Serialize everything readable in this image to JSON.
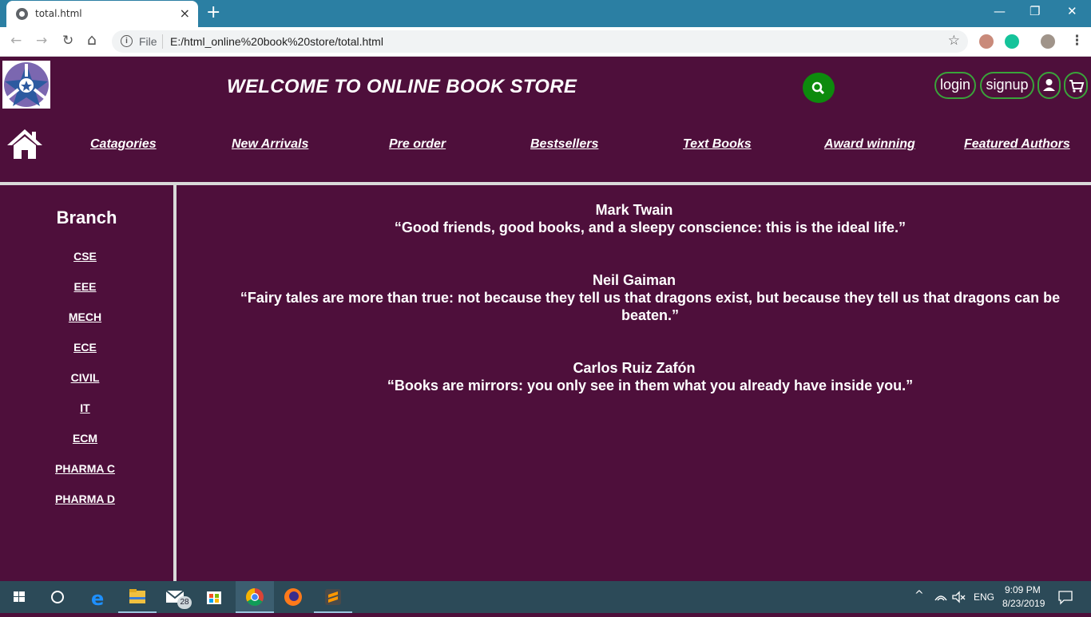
{
  "browser": {
    "tab_title": "total.html",
    "tab_close": "×",
    "new_tab": "+",
    "window_controls": {
      "minimize": "—",
      "restore": "❐",
      "close": "✕"
    },
    "nav": {
      "back": "←",
      "forward": "→",
      "reload": "↻",
      "home": "⌂"
    },
    "omnibox": {
      "info": "i",
      "scheme": "File",
      "url": "E:/html_online%20book%20store/total.html"
    },
    "bookmark_star": "☆",
    "menu": "⋮"
  },
  "header": {
    "title": "WELCOME TO ONLINE BOOK STORE",
    "login_label": "login",
    "signup_label": "signup"
  },
  "nav": {
    "links": [
      "Catagories",
      "New Arrivals",
      "Pre order",
      "Bestsellers",
      "Text Books",
      "Award winning",
      "Featured Authors"
    ]
  },
  "sidebar": {
    "title": "Branch",
    "items": [
      "CSE",
      "EEE",
      "MECH",
      "ECE",
      "CIVIL",
      "IT",
      "ECM",
      "PHARMA C",
      "PHARMA D"
    ]
  },
  "quotes": [
    {
      "author": "Mark Twain",
      "text": "“Good friends, good books, and a sleepy conscience: this is the ideal life.”"
    },
    {
      "author": "Neil Gaiman",
      "text": "“Fairy tales are more than true: not because they tell us that dragons exist, but because they tell us that dragons can be beaten.”"
    },
    {
      "author": "Carlos Ruiz Zafón",
      "text": "“Books are mirrors: you only see in them what you already have inside you.”"
    }
  ],
  "taskbar": {
    "mail_badge": "28",
    "language": "ENG",
    "time": "9:09 PM",
    "date": "8/23/2019"
  },
  "colors": {
    "page_bg": "#4e0f3b",
    "titlebar": "#2b7fa3",
    "accent_green": "#0d8a0d",
    "taskbar": "#2c4a58"
  }
}
